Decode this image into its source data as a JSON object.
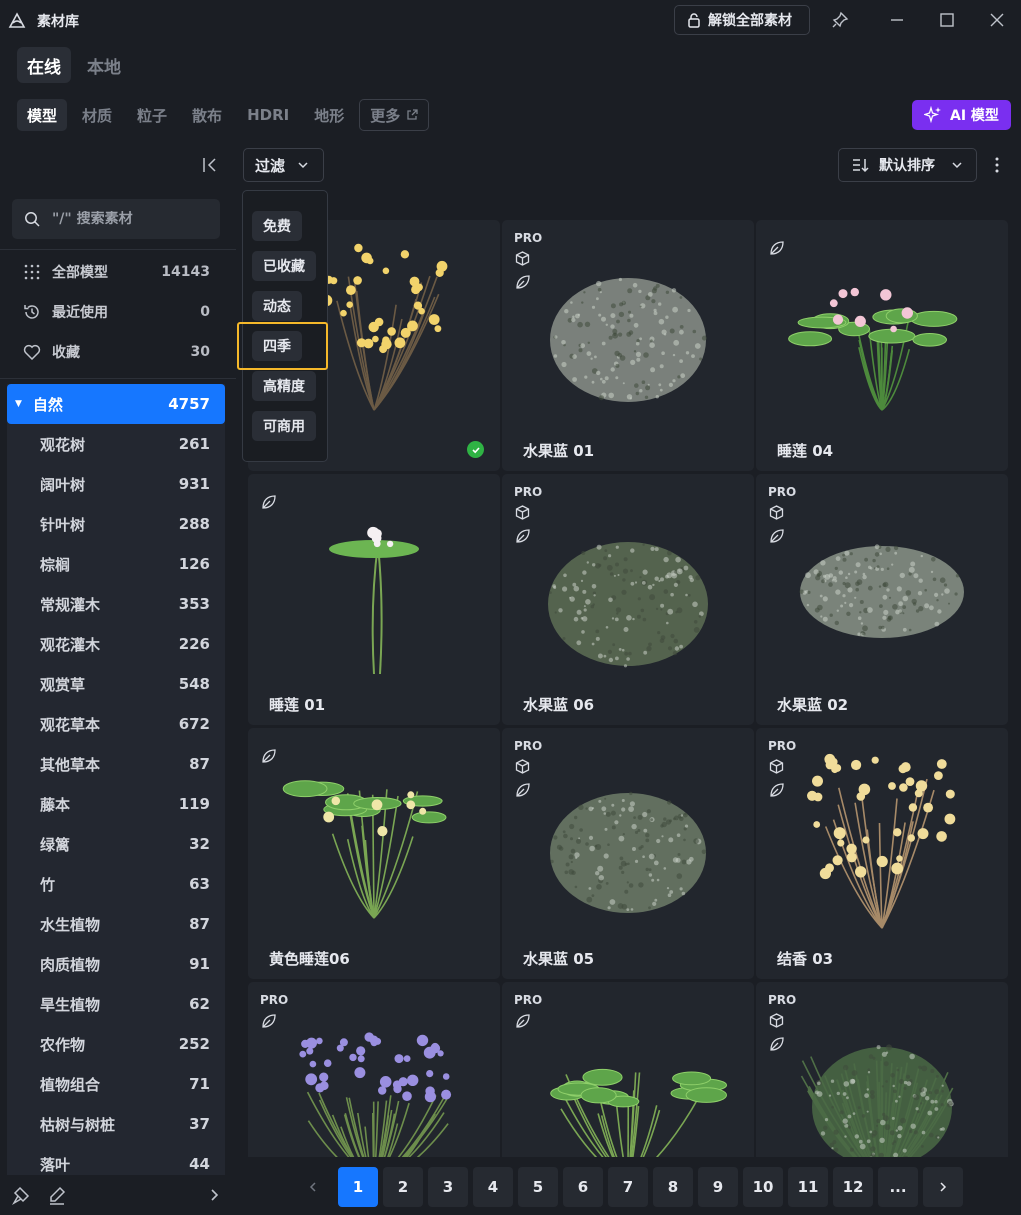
{
  "app": {
    "title": "素材库",
    "unlock_label": "解锁全部素材"
  },
  "source_tabs": [
    {
      "label": "在线",
      "active": true
    },
    {
      "label": "本地",
      "active": false
    }
  ],
  "category_tabs": [
    {
      "label": "模型",
      "active": true
    },
    {
      "label": "材质"
    },
    {
      "label": "粒子"
    },
    {
      "label": "散布"
    },
    {
      "label": "HDRI"
    },
    {
      "label": "地形"
    },
    {
      "label": "更多"
    }
  ],
  "ai_button": {
    "label": "AI 模型"
  },
  "search": {
    "placeholder": "\"/\" 搜索素材"
  },
  "quick_items": [
    {
      "label": "全部模型",
      "count": "14143",
      "icon": "grid-dots-icon"
    },
    {
      "label": "最近使用",
      "count": "0",
      "icon": "history-icon"
    },
    {
      "label": "收藏",
      "count": "30",
      "icon": "heart-icon"
    }
  ],
  "tree": {
    "parent": {
      "label": "自然",
      "count": "4757"
    },
    "children": [
      {
        "label": "观花树",
        "count": "261"
      },
      {
        "label": "阔叶树",
        "count": "931"
      },
      {
        "label": "针叶树",
        "count": "288"
      },
      {
        "label": "棕榈",
        "count": "126"
      },
      {
        "label": "常规灌木",
        "count": "353"
      },
      {
        "label": "观花灌木",
        "count": "226"
      },
      {
        "label": "观赏草",
        "count": "548"
      },
      {
        "label": "观花草本",
        "count": "672"
      },
      {
        "label": "其他草本",
        "count": "87"
      },
      {
        "label": "藤本",
        "count": "119"
      },
      {
        "label": "绿篱",
        "count": "32"
      },
      {
        "label": "竹",
        "count": "63"
      },
      {
        "label": "水生植物",
        "count": "87"
      },
      {
        "label": "肉质植物",
        "count": "91"
      },
      {
        "label": "旱生植物",
        "count": "62"
      },
      {
        "label": "农作物",
        "count": "252"
      },
      {
        "label": "植物组合",
        "count": "71"
      },
      {
        "label": "枯树与树桩",
        "count": "37"
      },
      {
        "label": "落叶",
        "count": "44"
      }
    ]
  },
  "toolbar": {
    "filter_label": "过滤",
    "sort_label": "默认排序"
  },
  "filter_options": [
    {
      "label": "免费"
    },
    {
      "label": "已收藏"
    },
    {
      "label": "动态"
    },
    {
      "label": "四季",
      "highlighted": true
    },
    {
      "label": "高精度"
    },
    {
      "label": "可商用"
    }
  ],
  "assets": [
    {
      "name": "",
      "pro": false,
      "cube": false,
      "leaf": false,
      "downloaded": true,
      "plant": "flower-shrub-yellow"
    },
    {
      "name": "水果蓝 01",
      "pro": true,
      "cube": true,
      "leaf": true,
      "plant": "bush-grey"
    },
    {
      "name": "睡莲 04",
      "pro": false,
      "cube": false,
      "leaf": true,
      "plant": "water-lily-pink"
    },
    {
      "name": "睡莲 01",
      "pro": false,
      "cube": false,
      "leaf": true,
      "plant": "water-lily-single"
    },
    {
      "name": "水果蓝 06",
      "pro": true,
      "cube": true,
      "leaf": true,
      "plant": "bush-green"
    },
    {
      "name": "水果蓝 02",
      "pro": true,
      "cube": true,
      "leaf": true,
      "plant": "bush-flat"
    },
    {
      "name": "黄色睡莲06",
      "pro": false,
      "cube": false,
      "leaf": true,
      "plant": "water-lily-yellow"
    },
    {
      "name": "水果蓝 05",
      "pro": true,
      "cube": true,
      "leaf": true,
      "plant": "bush-dome"
    },
    {
      "name": "结香 03",
      "pro": true,
      "cube": true,
      "leaf": true,
      "plant": "flower-shrub-pale"
    },
    {
      "name": "",
      "pro": true,
      "cube": false,
      "leaf": true,
      "plant": "iris-purple"
    },
    {
      "name": "",
      "pro": true,
      "cube": false,
      "leaf": true,
      "plant": "lily-pads"
    },
    {
      "name": "",
      "pro": true,
      "cube": true,
      "leaf": true,
      "plant": "grass-shrub"
    }
  ],
  "pagination": {
    "pages": [
      "1",
      "2",
      "3",
      "4",
      "5",
      "6",
      "7",
      "8",
      "9",
      "10",
      "11",
      "12",
      "..."
    ],
    "current": "1"
  },
  "colors": {
    "accent": "#1677ff",
    "ai": "#7a2ff0",
    "highlight": "#f5b82a",
    "success": "#2fb344"
  }
}
